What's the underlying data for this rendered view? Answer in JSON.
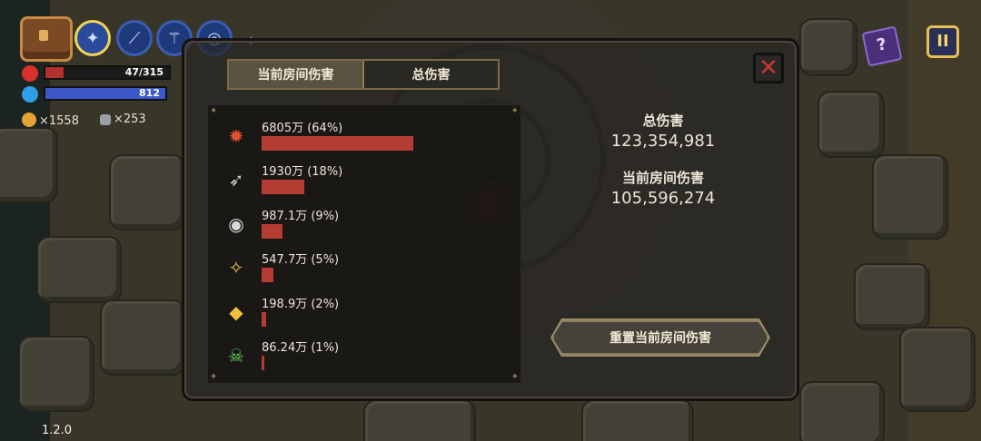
{
  "hud": {
    "hp_text": "47/315",
    "hp_fraction": 0.149,
    "mp_text": "812",
    "mp_fraction": 1.0,
    "gold": "×1558",
    "keys": "×253",
    "version": "1.2.0",
    "skills": [
      {
        "icon": "wand-icon",
        "glyph": "✦",
        "active": true
      },
      {
        "icon": "spear-icon",
        "glyph": "⟋",
        "active": false
      },
      {
        "icon": "staff-icon",
        "glyph": "⚚",
        "active": false
      },
      {
        "icon": "orb-icon",
        "glyph": "◎",
        "active": false
      }
    ],
    "collapse_glyph": "‹",
    "book_glyph": "?",
    "pause_glyph": "II"
  },
  "panel": {
    "tabs": [
      "当前房间伤害",
      "总伤害"
    ],
    "selected_tab": 0,
    "close_glyph": "✕",
    "rows": [
      {
        "label": "6805万 (64%)",
        "percent": 64,
        "icon": "fire-burst-icon",
        "glyph": "✹",
        "color": "#e0502a"
      },
      {
        "label": "1930万 (18%)",
        "percent": 18,
        "icon": "arrow-icon",
        "glyph": "➶",
        "color": "#cfcfcf"
      },
      {
        "label": "987.1万 (9%)",
        "percent": 9,
        "icon": "eye-target-icon",
        "glyph": "◉",
        "color": "#d8d8d8"
      },
      {
        "label": "547.7万 (5%)",
        "percent": 5,
        "icon": "crystal-shard-icon",
        "glyph": "✧",
        "color": "#f0c23c"
      },
      {
        "label": "198.9万 (2%)",
        "percent": 2,
        "icon": "gold-shard-icon",
        "glyph": "◆",
        "color": "#f2c040"
      },
      {
        "label": "86.24万 (1%)",
        "percent": 1,
        "icon": "skull-icon",
        "glyph": "☠",
        "color": "#5fd25a"
      }
    ],
    "total_title": "总伤害",
    "total_value": "123,354,981",
    "room_title": "当前房间伤害",
    "room_value": "105,596,274",
    "reset_label": "重置当前房间伤害"
  },
  "colors": {
    "hp": "#b4302c",
    "mp": "#3c58c8",
    "bar": "#b53c34"
  }
}
